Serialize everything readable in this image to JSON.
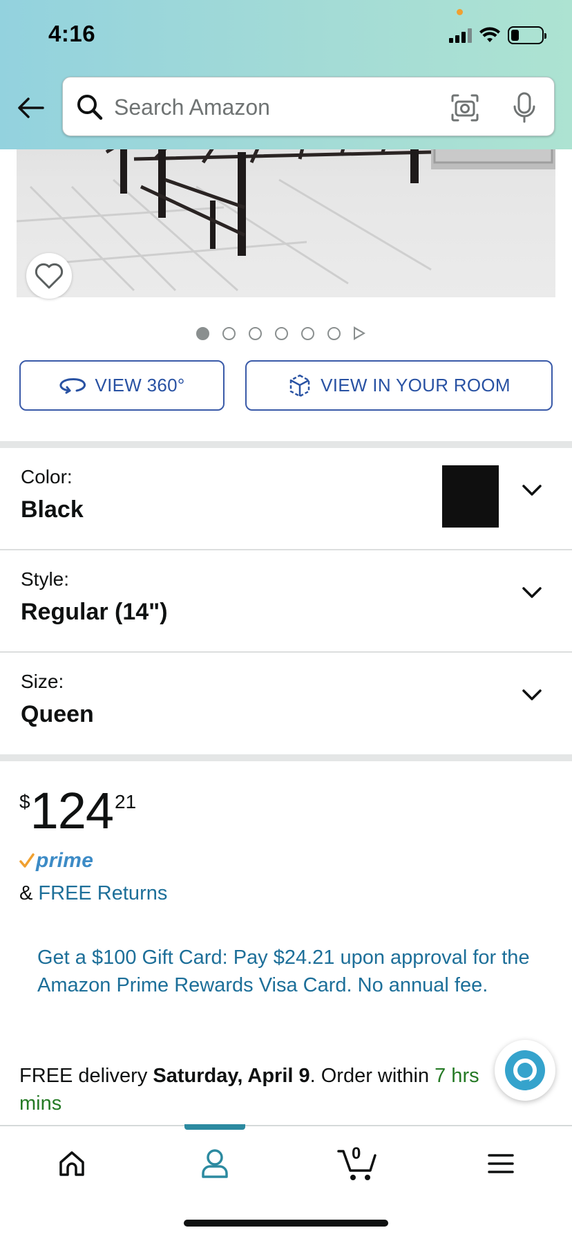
{
  "status_bar": {
    "time": "4:16"
  },
  "header": {
    "search": {
      "placeholder": "Search Amazon",
      "value": ""
    }
  },
  "carousel": {
    "total_images": 6,
    "active_index": 0,
    "has_video": true
  },
  "view_buttons": {
    "view_360": "VIEW 360°",
    "view_in_room": "VIEW IN YOUR ROOM"
  },
  "variations": {
    "color": {
      "label": "Color:",
      "value": "Black",
      "swatch": "#0f0f0f"
    },
    "style": {
      "label": "Style:",
      "value": "Regular (14\")"
    },
    "size": {
      "label": "Size:",
      "value": "Queen"
    }
  },
  "price": {
    "currency": "$",
    "whole": "124",
    "fraction": "21"
  },
  "prime": {
    "label": "prime",
    "returns_prefix": "& ",
    "returns_link": "FREE Returns"
  },
  "promo": {
    "text": "Get a $100 Gift Card: Pay $24.21 upon approval for the Amazon Prime Rewards Visa Card. No annual fee."
  },
  "delivery": {
    "prefix": "FREE delivery ",
    "date": "Saturday, April 9",
    "middle": ". Order within ",
    "countdown": "7 hrs",
    "countdown_end": "mins"
  },
  "bottom_nav": {
    "active": "account",
    "cart_count": "0"
  },
  "colors": {
    "accent_blue": "#2952a3",
    "link_teal": "#1d6f99",
    "prime_blue": "#3c8bc6",
    "green": "#257a25",
    "nav_active": "#2c8aa0"
  }
}
